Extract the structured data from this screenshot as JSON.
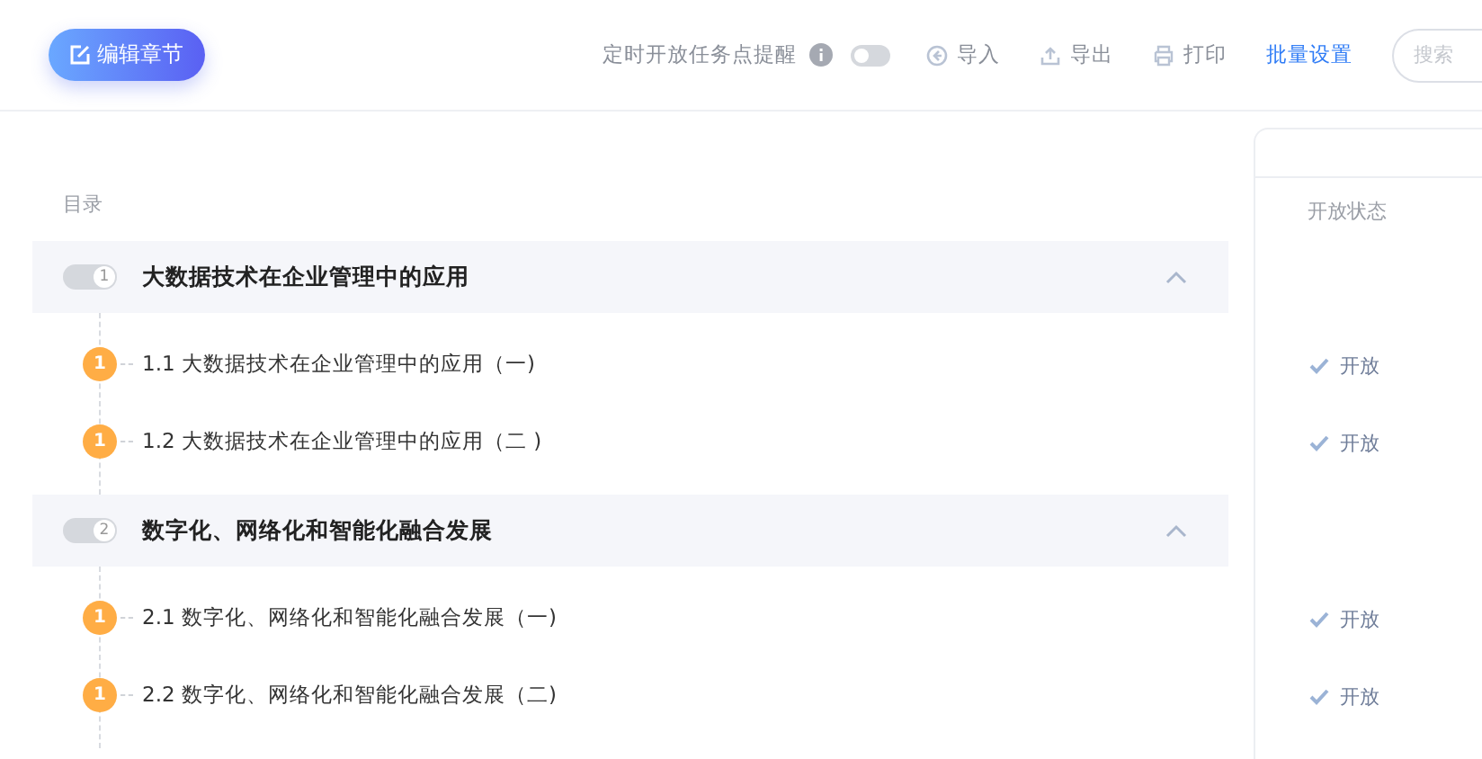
{
  "toolbar": {
    "edit_button": "编辑章节",
    "reminder": {
      "label": "定时开放任务点提醒",
      "on": false
    },
    "actions": [
      {
        "kind": "import",
        "label": "导入"
      },
      {
        "kind": "export",
        "label": "导出"
      },
      {
        "kind": "print",
        "label": "打印"
      },
      {
        "kind": "link",
        "label": "批量设置"
      }
    ],
    "search": {
      "placeholder": "搜索"
    }
  },
  "catalog": {
    "label": "目录",
    "chapters": [
      {
        "number": "1",
        "title": "大数据技术在企业管理中的应用",
        "on": true,
        "disabled": true,
        "expanded": true,
        "sections": [
          {
            "badge": "1",
            "title": "1.1 大数据技术在企业管理中的应用（一)",
            "status": "开放"
          },
          {
            "badge": "1",
            "title": "1.2 大数据技术在企业管理中的应用（二 )",
            "status": "开放"
          }
        ]
      },
      {
        "number": "2",
        "title": "数字化、网络化和智能化融合发展",
        "on": true,
        "disabled": true,
        "expanded": true,
        "sections": [
          {
            "badge": "1",
            "title": "2.1 数字化、网络化和智能化融合发展（一)",
            "status": "开放"
          },
          {
            "badge": "1",
            "title": "2.2 数字化、网络化和智能化融合发展（二)",
            "status": "开放"
          }
        ]
      }
    ]
  },
  "status_panel": {
    "column": "开放状态"
  }
}
